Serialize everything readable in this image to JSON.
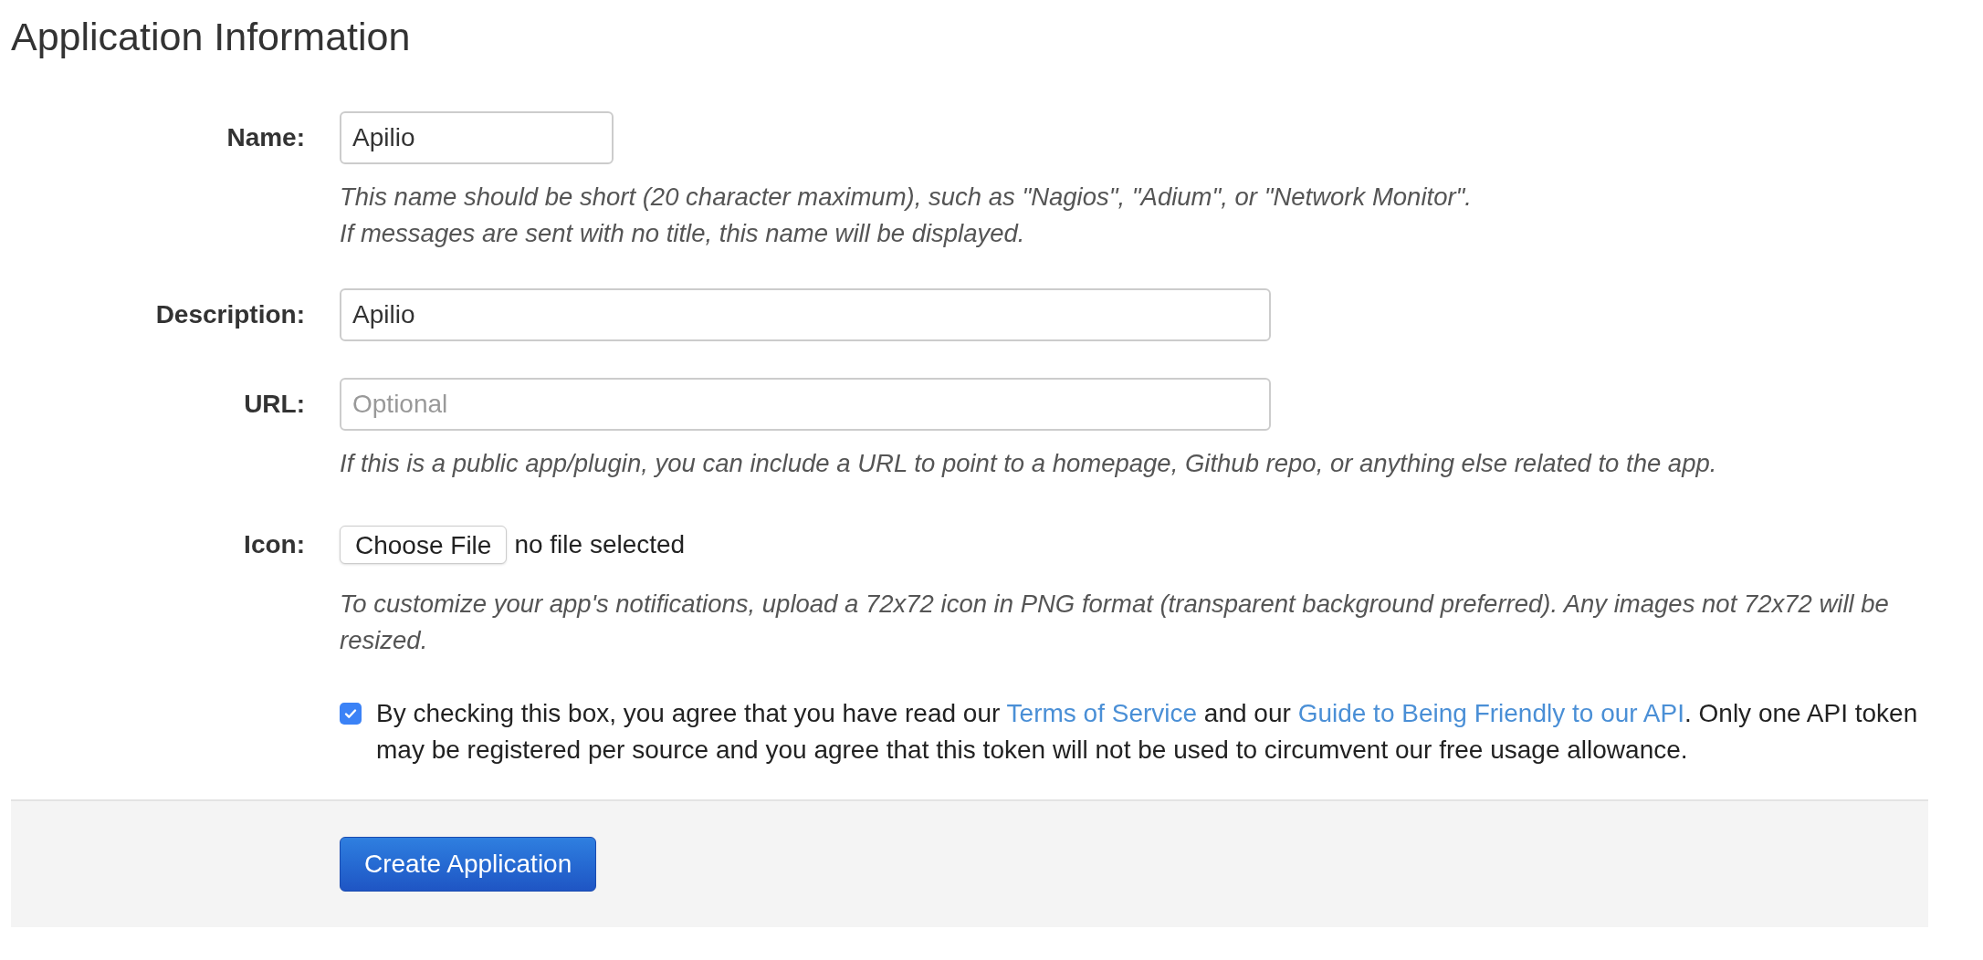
{
  "title": "Application Information",
  "fields": [
    {
      "kind": "short-text",
      "label": "Name:",
      "value": "Apilio",
      "help": [
        "This name should be short (20 character maximum), such as \"Nagios\", \"Adium\", or \"Network Monitor\".",
        "If messages are sent with no title, this name will be displayed."
      ]
    },
    {
      "kind": "text",
      "label": "Description:",
      "value": "Apilio"
    },
    {
      "kind": "text",
      "label": "URL:",
      "placeholder": "Optional",
      "help": [
        "If this is a public app/plugin, you can include a URL to point to a homepage, Github repo, or anything else related to the app."
      ]
    },
    {
      "kind": "file",
      "label": "Icon:",
      "button": "Choose File",
      "status": "no file selected",
      "help": [
        "To customize your app's notifications, upload a 72x72 icon in PNG format (transparent background preferred). Any images not 72x72 will be resized."
      ]
    }
  ],
  "agreement": {
    "checked": true,
    "parts": [
      {
        "kind": "text",
        "text": "By checking this box, you agree that you have read our "
      },
      {
        "kind": "link",
        "text": "Terms of Service"
      },
      {
        "kind": "text",
        "text": " and our "
      },
      {
        "kind": "link",
        "text": "Guide to Being Friendly to our API"
      },
      {
        "kind": "text",
        "text": ". Only one API token may be registered per source and you agree that this token will not be used to circumvent our free usage allowance."
      }
    ]
  },
  "submit": "Create Application"
}
